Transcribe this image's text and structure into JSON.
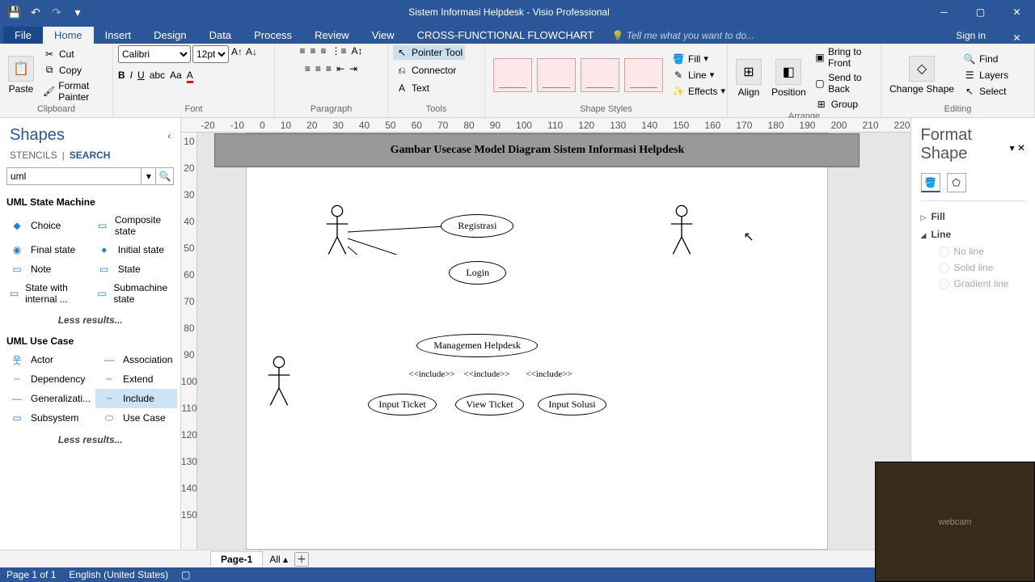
{
  "titlebar": {
    "title": "Sistem Informasi Helpdesk - Visio Professional"
  },
  "tabs": {
    "file": "File",
    "home": "Home",
    "insert": "Insert",
    "design": "Design",
    "data": "Data",
    "process": "Process",
    "review": "Review",
    "view": "View",
    "cff": "CROSS-FUNCTIONAL FLOWCHART",
    "tellme": "Tell me what you want to do...",
    "signin": "Sign in"
  },
  "ribbon": {
    "clipboard": {
      "paste": "Paste",
      "cut": "Cut",
      "copy": "Copy",
      "fmtpaint": "Format Painter",
      "label": "Clipboard"
    },
    "font": {
      "name": "Calibri",
      "size": "12pt",
      "label": "Font"
    },
    "paragraph": {
      "label": "Paragraph"
    },
    "tools": {
      "pointer": "Pointer Tool",
      "connector": "Connector",
      "text": "Text",
      "label": "Tools"
    },
    "shapestyles": {
      "label": "Shape Styles",
      "fill": "Fill",
      "line": "Line",
      "effects": "Effects"
    },
    "arrange": {
      "align": "Align",
      "position": "Position",
      "bringfront": "Bring to Front",
      "sendback": "Send to Back",
      "group": "Group",
      "changeshape": "Change Shape",
      "label": "Arrange"
    },
    "editing": {
      "find": "Find",
      "layers": "Layers",
      "select": "Select",
      "label": "Editing"
    }
  },
  "shapes": {
    "title": "Shapes",
    "stencils": "STENCILS",
    "search": "SEARCH",
    "query": "uml",
    "cat1": "UML State Machine",
    "items1": [
      {
        "l": "Choice"
      },
      {
        "l": "Composite state"
      },
      {
        "l": "Final state"
      },
      {
        "l": "Initial state"
      },
      {
        "l": "Note"
      },
      {
        "l": "State"
      },
      {
        "l": "State with internal ..."
      },
      {
        "l": "Submachine state"
      }
    ],
    "less": "Less results...",
    "cat2": "UML Use Case",
    "items2": [
      {
        "l": "Actor"
      },
      {
        "l": "Association"
      },
      {
        "l": "Dependency"
      },
      {
        "l": "Extend"
      },
      {
        "l": "Generalizati..."
      },
      {
        "l": "Include",
        "sel": true
      },
      {
        "l": "Subsystem"
      },
      {
        "l": "Use Case"
      }
    ]
  },
  "diagram": {
    "title": "Gambar Usecase Model Diagram Sistem Informasi Helpdesk",
    "uc": {
      "registrasi": "Registrasi",
      "login": "Login",
      "mgmt": "Managemen Helpdesk",
      "input_ticket": "Input Ticket",
      "view_ticket": "View Ticket",
      "input_solusi": "Input Solusi"
    },
    "include": "<<include>>"
  },
  "fmt": {
    "title": "Format Shape",
    "fill": "Fill",
    "line": "Line",
    "noline": "No line",
    "solid": "Solid line",
    "gradient": "Gradient line"
  },
  "tabbar": {
    "page": "Page-1",
    "all": "All"
  },
  "status": {
    "pages": "Page 1 of 1",
    "lang": "English (United States)"
  },
  "ruler_h": [
    "-20",
    "-10",
    "0",
    "10",
    "20",
    "30",
    "40",
    "50",
    "60",
    "70",
    "80",
    "90",
    "100",
    "110",
    "120",
    "130",
    "140",
    "150",
    "160",
    "170",
    "180",
    "190",
    "200",
    "210",
    "220"
  ],
  "ruler_v": [
    "10",
    "20",
    "30",
    "40",
    "50",
    "60",
    "70",
    "80",
    "90",
    "100",
    "110",
    "120",
    "130",
    "140",
    "150"
  ]
}
